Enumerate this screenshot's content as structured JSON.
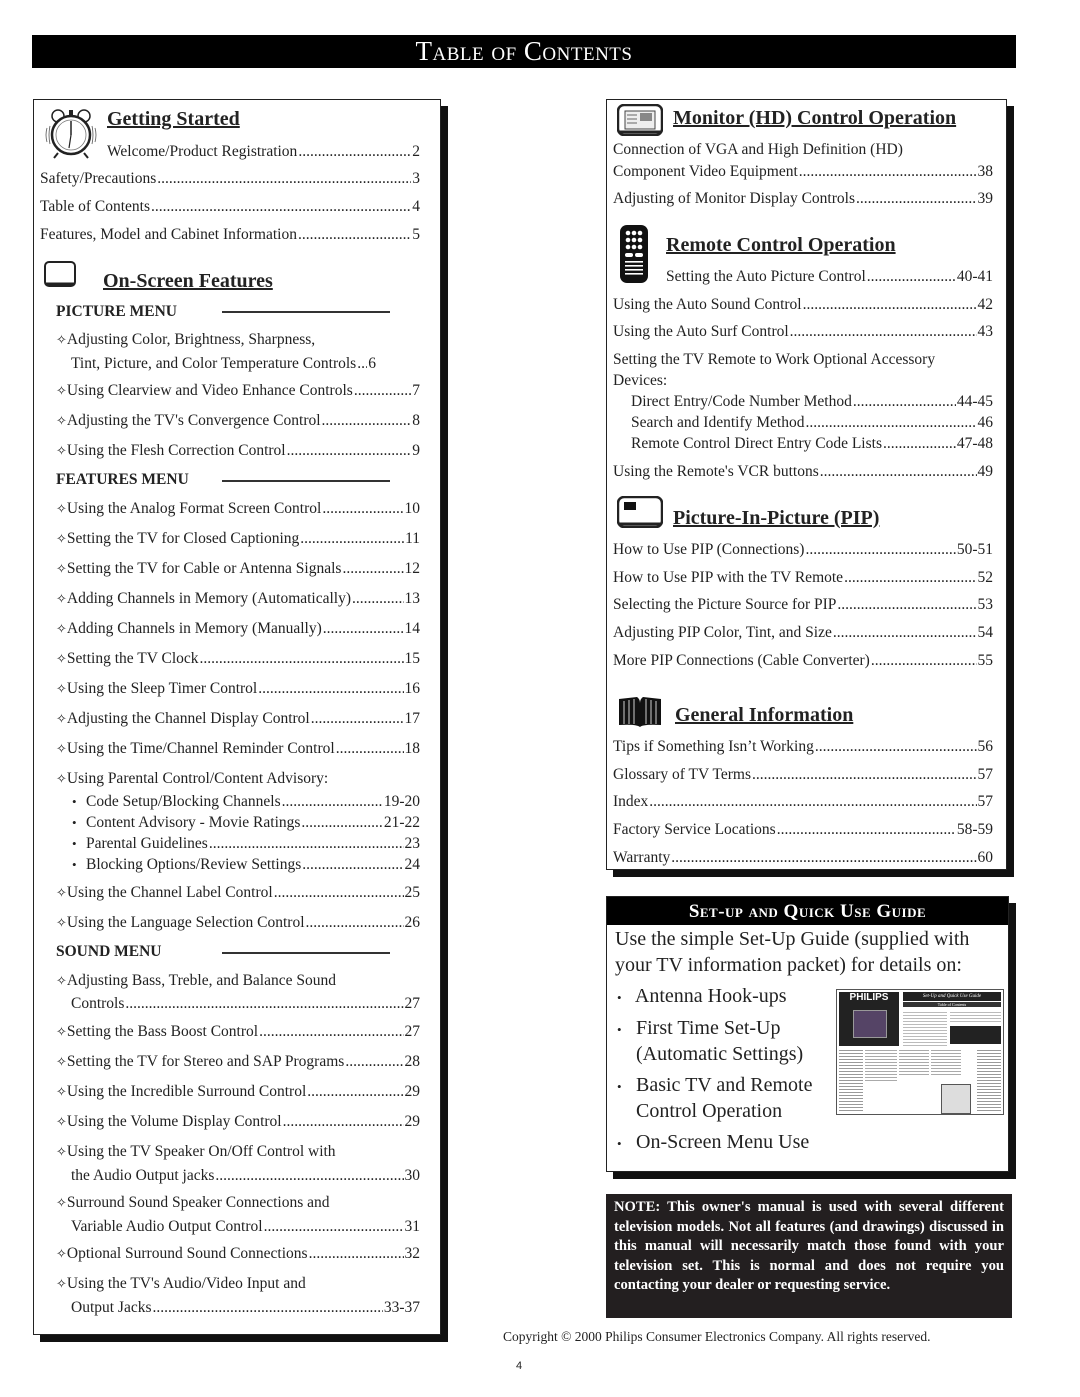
{
  "title": "Table of Contents",
  "left": {
    "getting_started": {
      "heading": "Getting Started",
      "icon": "alarm-clock-icon",
      "items": [
        {
          "label": "Welcome/Product Registration",
          "page": "2"
        },
        {
          "label": "Safety/Precautions",
          "page": "3"
        },
        {
          "label": "Table of Contents",
          "page": "4"
        },
        {
          "label": "Features, Model and Cabinet Information",
          "page": "5"
        }
      ]
    },
    "on_screen": {
      "heading": "On-Screen Features",
      "icon": "tv-screen-icon",
      "picture_menu": {
        "heading": "PICTURE MENU",
        "items": [
          {
            "label": "Adjusting Color, Brightness, Sharpness,",
            "cont": "Tint, Picture, and Color Temperature Controls",
            "page": "6"
          },
          {
            "label": "Using Clearview and Video Enhance Controls",
            "page": "7"
          },
          {
            "label": "Adjusting the TV's Convergence Control",
            "page": "8"
          },
          {
            "label": "Using the Flesh Correction Control",
            "page": "9"
          }
        ]
      },
      "features_menu": {
        "heading": "FEATURES MENU",
        "items": [
          {
            "label": "Using the Analog Format Screen Control",
            "page": "10"
          },
          {
            "label": "Setting the TV for Closed Captioning",
            "page": "11"
          },
          {
            "label": "Setting the TV for Cable or Antenna Signals",
            "page": "12"
          },
          {
            "label": "Adding Channels in Memory (Automatically)",
            "page": "13"
          },
          {
            "label": "Adding Channels in Memory (Manually)",
            "page": "14"
          },
          {
            "label": "Setting the TV Clock",
            "page": "15"
          },
          {
            "label": "Using the Sleep Timer Control",
            "page": "16"
          },
          {
            "label": "Adjusting the Channel Display Control",
            "page": "17"
          },
          {
            "label": "Using the Time/Channel Reminder Control",
            "page": "18"
          },
          {
            "label": "Using Parental Control/Content Advisory:",
            "page": ""
          },
          {
            "label": "Using the Channel Label Control",
            "page": "25"
          },
          {
            "label": "Using the Language Selection Control",
            "page": "26"
          }
        ],
        "parental_sub": [
          {
            "label": "Code Setup/Blocking Channels",
            "page": "19-20"
          },
          {
            "label": "Content Advisory - Movie Ratings",
            "page": "21-22"
          },
          {
            "label": "Parental Guidelines",
            "page": "23"
          },
          {
            "label": "Blocking Options/Review Settings",
            "page": "24"
          }
        ]
      },
      "sound_menu": {
        "heading": "SOUND MENU",
        "items": [
          {
            "label": "Adjusting Bass, Treble, and Balance Sound",
            "cont": "Controls",
            "page": "27"
          },
          {
            "label": "Setting the Bass Boost Control",
            "page": "27"
          },
          {
            "label": "Setting the TV for Stereo and SAP Programs",
            "page": "28"
          },
          {
            "label": "Using the Incredible Surround Control",
            "page": "29"
          },
          {
            "label": "Using the Volume Display Control",
            "page": "29"
          },
          {
            "label": "Using the TV Speaker On/Off Control with",
            "cont": "the Audio Output jacks",
            "page": "30"
          },
          {
            "label": "Surround Sound Speaker Connections and",
            "cont": "Variable Audio Output Control",
            "page": "31"
          },
          {
            "label": "Optional Surround Sound Connections",
            "page": "32"
          },
          {
            "label": "Using the TV's Audio/Video Input and",
            "cont": "Output Jacks",
            "page": "33-37"
          }
        ]
      }
    }
  },
  "right": {
    "monitor": {
      "heading": "Monitor (HD) Control Operation",
      "icon": "monitor-icon",
      "items": [
        {
          "label": "Connection of VGA and High Definition (HD)",
          "cont": "Component Video Equipment",
          "page": "38"
        },
        {
          "label": "Adjusting of Monitor Display Controls",
          "page": "39"
        }
      ]
    },
    "remote": {
      "heading": "Remote Control Operation",
      "icon": "remote-control-icon",
      "items": [
        {
          "label": "Setting the Auto Picture Control",
          "page": "40-41"
        },
        {
          "label": "Using the Auto Sound Control",
          "page": "42"
        },
        {
          "label": "Using the Auto Surf Control",
          "page": "43"
        },
        {
          "label": "Setting the TV Remote to Work Optional Accessory",
          "cont": "Devices:",
          "page": ""
        },
        {
          "label": "Using the Remote's VCR buttons",
          "page": "49"
        }
      ],
      "sub": [
        {
          "label": "Direct Entry/Code Number Method",
          "page": "44-45"
        },
        {
          "label": "Search and Identify Method",
          "page": "46"
        },
        {
          "label": "Remote Control Direct Entry Code Lists",
          "page": "47-48"
        }
      ]
    },
    "pip": {
      "heading": "Picture-In-Picture (PIP)",
      "icon": "pip-screen-icon",
      "items": [
        {
          "label": "How to Use PIP (Connections)",
          "page": "50-51"
        },
        {
          "label": "How to Use PIP with the TV Remote",
          "page": "52"
        },
        {
          "label": "Selecting the Picture Source for PIP",
          "page": "53"
        },
        {
          "label": "Adjusting PIP Color, Tint, and Size",
          "page": "54"
        },
        {
          "label": "More PIP Connections (Cable Converter)",
          "page": "55"
        }
      ]
    },
    "general": {
      "heading": "General Information",
      "icon": "open-book-icon",
      "items": [
        {
          "label": "Tips if Something Isn’t Working",
          "page": "56"
        },
        {
          "label": "Glossary of TV Terms",
          "page": "57"
        },
        {
          "label": "Index",
          "page": "57"
        },
        {
          "label": "Factory Service Locations",
          "page": "58-59"
        },
        {
          "label": "Warranty",
          "page": "60"
        }
      ]
    }
  },
  "guide": {
    "heading": "Set-up and Quick Use Guide",
    "intro_line1": "Use the simple Set-Up Guide (supplied with",
    "intro_line2": "your TV information packet) for details on:",
    "items": [
      {
        "line1": "Antenna Hook-ups"
      },
      {
        "line1": "First Time Set-Up",
        "line2": "(Automatic Settings)"
      },
      {
        "line1": "Basic TV and Remote",
        "line2": "Control Operation"
      },
      {
        "line1": "On-Screen Menu Use"
      }
    ],
    "thumbnail": {
      "brand": "PHILIPS",
      "title": "Set-Up and Quick Use Guide",
      "subtitle": "Table of Contents"
    }
  },
  "note": "NOTE: This owner's manual is used with several different television models. Not all features (and drawings) discussed in this manual will necessarily match those found with your television set. This is normal and does not require you contacting your dealer or requesting service.",
  "copyright": "Copyright © 2000 Philips Consumer Electronics Company. All rights reserved.",
  "page_number": "4",
  "symbols": {
    "diamond": "✧",
    "bullet": "•"
  }
}
